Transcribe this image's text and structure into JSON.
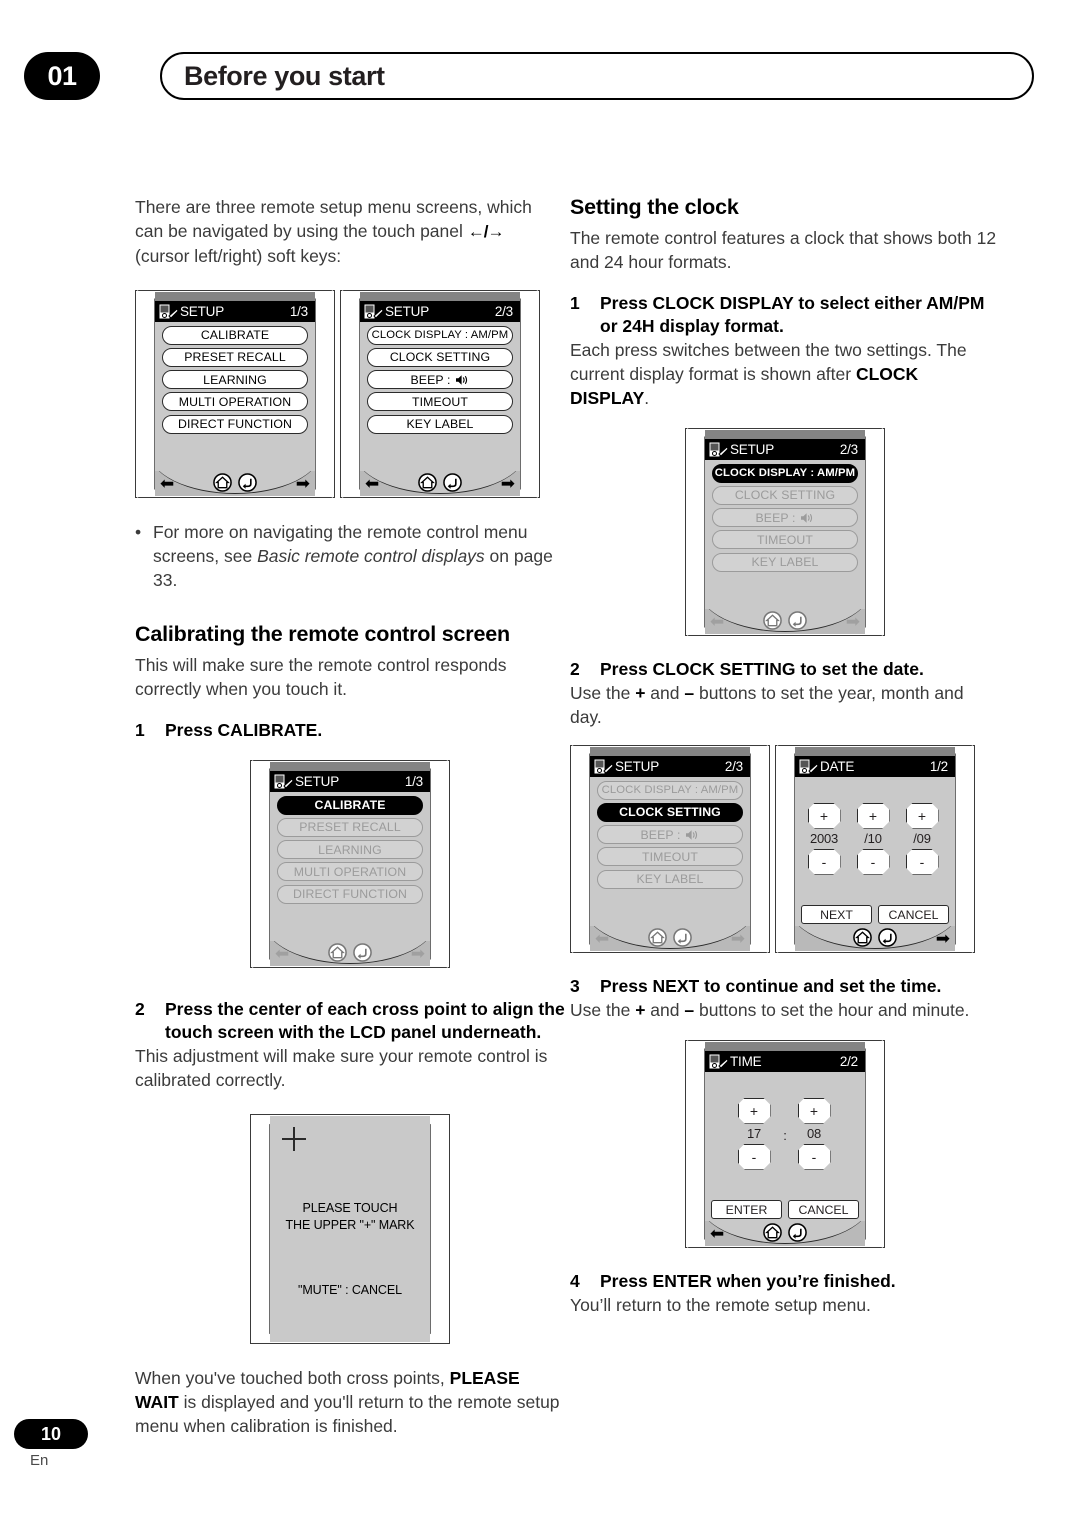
{
  "header": {
    "chapter_number": "01",
    "chapter_title": "Before you start"
  },
  "footer": {
    "page_number": "10",
    "language": "En"
  },
  "left_column": {
    "intro_line1": "There are three remote setup menu screens, which",
    "intro_line2_a": "can be navigated by using the touch panel ",
    "intro_line2_arrows": "←/→",
    "intro_line3": "(cursor left/right) soft keys:",
    "bullet_dot": "•",
    "bullet_a": "For more on navigating the remote control menu screens, see ",
    "bullet_italic": "Basic remote control displays",
    "bullet_b": " on page 33.",
    "section_title": "Calibrating the remote control screen",
    "section_body": "This will make sure the remote control responds correctly when you touch it.",
    "step1_num": "1",
    "step1_text": "Press CALIBRATE.",
    "step2_num": "2",
    "step2_text": "Press the center of each cross point to align the touch screen with the LCD panel underneath.",
    "step2_body": "This adjustment will make sure your remote control is calibrated correctly.",
    "closing_a": "When you've touched both cross points, ",
    "closing_bold": "PLEASE WAIT",
    "closing_b": " is displayed and you'll return to the remote setup menu when calibration is finished."
  },
  "right_column": {
    "section_title": "Setting the clock",
    "section_body": "The remote control features a clock that shows both 12 and 24 hour formats.",
    "step1_num": "1",
    "step1_text": "Press CLOCK DISPLAY to select either AM/PM or 24H display format.",
    "step1_body_a": "Each press switches between the two settings. The current display format is shown after ",
    "step1_body_bold": "CLOCK DISPLAY",
    "step1_body_b": ".",
    "step2_num": "2",
    "step2_text": "Press CLOCK SETTING to set the date.",
    "step2_body_a": "Use the ",
    "step2_body_plus": "+",
    "step2_body_mid": " and ",
    "step2_body_minus": "–",
    "step2_body_b": " buttons to set the year, month and day.",
    "step3_num": "3",
    "step3_text": "Press NEXT to continue and set the time.",
    "step3_body_a": "Use the ",
    "step3_body_plus": "+",
    "step3_body_mid": " and ",
    "step3_body_minus": "–",
    "step3_body_b": " buttons to set the hour and minute.",
    "step4_num": "4",
    "step4_text": "Press ENTER when you’re finished.",
    "step4_body": "You’ll return to the remote setup menu."
  },
  "screens": {
    "setup1": {
      "title": "SETUP",
      "page": "1/3",
      "items": [
        "CALIBRATE",
        "PRESET RECALL",
        "LEARNING",
        "MULTI OPERATION",
        "DIRECT FUNCTION"
      ]
    },
    "setup2": {
      "title": "SETUP",
      "page": "2/3",
      "items": [
        "CLOCK DISPLAY : AM/PM",
        "CLOCK SETTING",
        "BEEP :",
        "TIMEOUT",
        "KEY LABEL"
      ]
    },
    "setup1_calibrate_selected": {
      "title": "SETUP",
      "page": "1/3",
      "items": [
        "CALIBRATE",
        "PRESET RECALL",
        "LEARNING",
        "MULTI OPERATION",
        "DIRECT FUNCTION"
      ],
      "selected_index": 0
    },
    "setup2_clockdisplay_selected": {
      "title": "SETUP",
      "page": "2/3",
      "items": [
        "CLOCK DISPLAY : AM/PM",
        "CLOCK SETTING",
        "BEEP :",
        "TIMEOUT",
        "KEY LABEL"
      ],
      "selected_index": 0
    },
    "setup2_clocksetting_selected": {
      "title": "SETUP",
      "page": "2/3",
      "items": [
        "CLOCK DISPLAY : AM/PM",
        "CLOCK SETTING",
        "BEEP :",
        "TIMEOUT",
        "KEY LABEL"
      ],
      "selected_index": 1
    },
    "date": {
      "title": "DATE",
      "page": "1/2",
      "plus": "+",
      "minus": "-",
      "values": [
        "2003",
        "/10",
        "/09"
      ],
      "action_left": "NEXT",
      "action_right": "CANCEL"
    },
    "time": {
      "title": "TIME",
      "page": "2/2",
      "plus": "+",
      "minus": "-",
      "values": [
        "17",
        "08"
      ],
      "separator": ":",
      "action_left": "ENTER",
      "action_right": "CANCEL"
    },
    "calibration": {
      "line1": "PLEASE TOUCH",
      "line2": "THE UPPER \"+\" MARK",
      "line3": "\"MUTE\" : CANCEL"
    }
  },
  "colors": {
    "ink": "#231f20",
    "body_text": "#3b3b3b",
    "lcd_background": "#c9c9c9",
    "lcd_titlebar": "#000000",
    "accent": "#000000"
  }
}
